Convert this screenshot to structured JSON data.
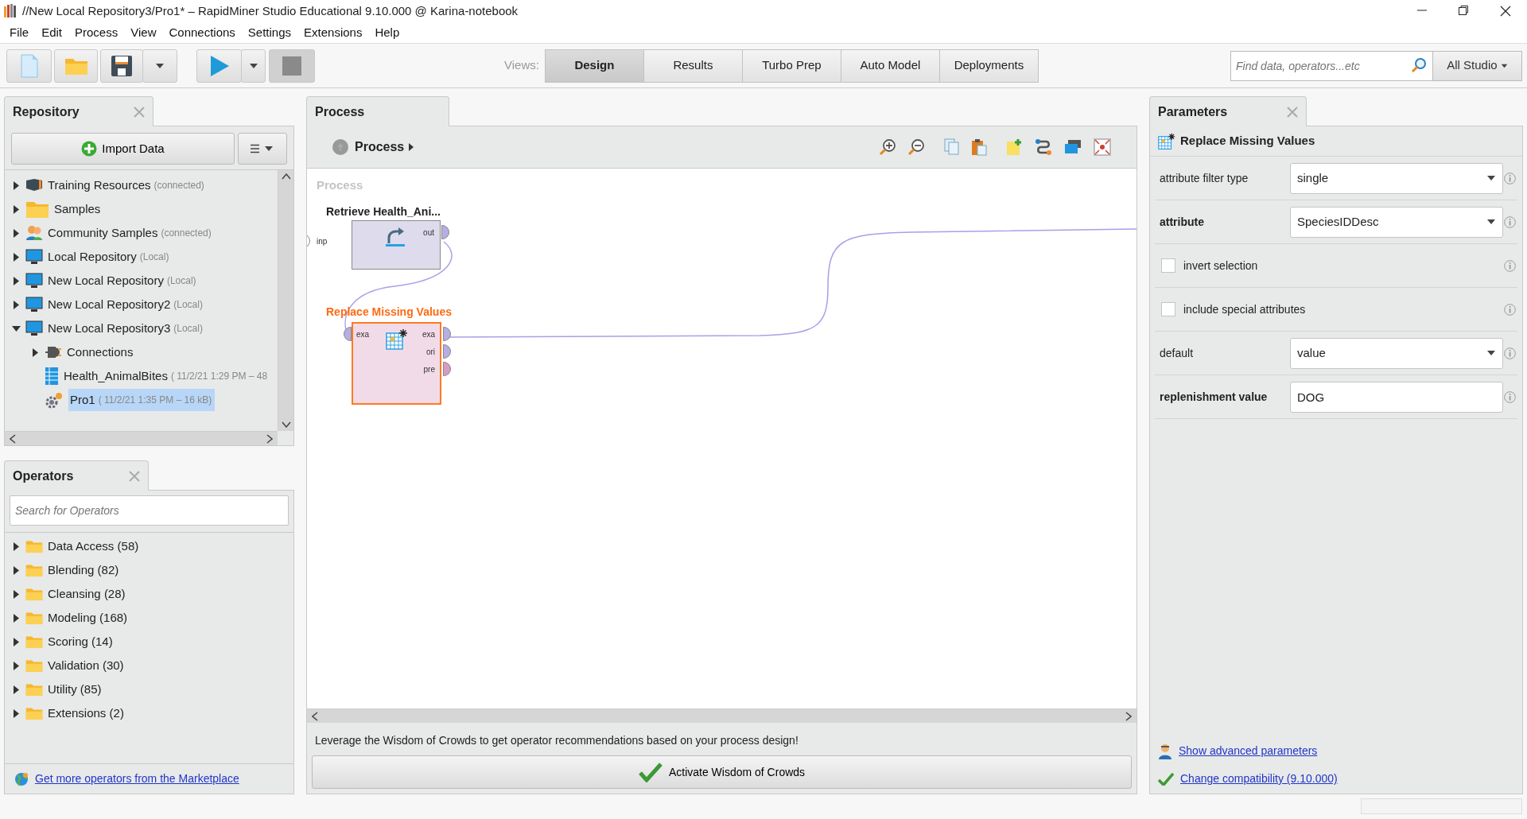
{
  "window": {
    "title": "//New Local Repository3/Pro1* – RapidMiner Studio Educational 9.10.000 @ Karina-notebook"
  },
  "menu": [
    "File",
    "Edit",
    "Process",
    "View",
    "Connections",
    "Settings",
    "Extensions",
    "Help"
  ],
  "toolbar": {
    "views_label": "Views:",
    "views": [
      {
        "label": "Design",
        "selected": true
      },
      {
        "label": "Results",
        "selected": false
      },
      {
        "label": "Turbo Prep",
        "selected": false
      },
      {
        "label": "Auto Model",
        "selected": false
      },
      {
        "label": "Deployments",
        "selected": false
      }
    ],
    "search_placeholder": "Find data, operators...etc",
    "scope": "All Studio"
  },
  "repository": {
    "title": "Repository",
    "import_button": "Import Data",
    "items": [
      {
        "kind": "training",
        "label": "Training Resources",
        "note": "(connected)",
        "expanded": false,
        "selected": false
      },
      {
        "kind": "folder",
        "label": "Samples",
        "expanded": false,
        "selected": false
      },
      {
        "kind": "community",
        "label": "Community Samples",
        "note": "(connected)",
        "expanded": false,
        "selected": false
      },
      {
        "kind": "repository",
        "label": "Local Repository",
        "note": "(Local)",
        "expanded": false,
        "selected": false
      },
      {
        "kind": "repository",
        "label": "New Local Repository",
        "note": "(Local)",
        "expanded": false,
        "selected": false
      },
      {
        "kind": "repository",
        "label": "New Local Repository2",
        "note": "(Local)",
        "expanded": false,
        "selected": false
      },
      {
        "kind": "repository",
        "label": "New Local Repository3",
        "note": "(Local)",
        "expanded": true,
        "selected": false,
        "children": [
          {
            "kind": "connections",
            "label": "Connections",
            "expanded": false,
            "selected": false
          },
          {
            "kind": "data",
            "label": "Health_AnimalBites",
            "note": "( 11/2/21 1:29 PM – 48",
            "selected": false
          },
          {
            "kind": "process",
            "label": "Pro1",
            "note": "( 11/2/21 1:35 PM – 16 kB)",
            "selected": true
          }
        ]
      }
    ]
  },
  "operators_panel": {
    "title": "Operators",
    "search_placeholder": "Search for Operators",
    "items": [
      {
        "label": "Data Access (58)",
        "expanded": false
      },
      {
        "label": "Blending (82)",
        "expanded": false
      },
      {
        "label": "Cleansing (28)",
        "expanded": false
      },
      {
        "label": "Modeling (168)",
        "expanded": false
      },
      {
        "label": "Scoring (14)",
        "expanded": false
      },
      {
        "label": "Validation (30)",
        "expanded": false
      },
      {
        "label": "Utility (85)",
        "expanded": false
      },
      {
        "label": "Extensions (2)",
        "expanded": false
      }
    ],
    "marketplace_link": "Get more operators from the Marketplace"
  },
  "process": {
    "tab": "Process",
    "breadcrumb": "Process",
    "canvas_label": "Process",
    "process_ports": [
      "inp"
    ],
    "operators": [
      {
        "kind": "retrieve",
        "title": "Retrieve Health_Ani...",
        "selected": false,
        "outputs": [
          {
            "label": "out",
            "color": "#b6aee3"
          }
        ]
      },
      {
        "kind": "replace",
        "title": "Replace Missing Values",
        "selected": true,
        "inputs": [
          {
            "label": "exa",
            "color": "#b6aee3"
          }
        ],
        "outputs": [
          {
            "label": "exa",
            "color": "#b6aee3"
          },
          {
            "label": "ori",
            "color": "#b6aee3"
          },
          {
            "label": "pre",
            "color": "#d99ac6"
          }
        ]
      }
    ],
    "wisdom_text": "Leverage the Wisdom of Crowds to get operator recommendations based on your process design!",
    "wisdom_button": "Activate Wisdom of Crowds"
  },
  "parameters": {
    "title": "Parameters",
    "operator": "Replace Missing Values",
    "rows": [
      {
        "kind": "select",
        "label": "attribute filter type",
        "required": false,
        "value": "single"
      },
      {
        "kind": "select",
        "label": "attribute",
        "required": true,
        "value": "SpeciesIDDesc"
      },
      {
        "kind": "checkbox",
        "label": "invert selection",
        "checked": false
      },
      {
        "kind": "checkbox",
        "label": "include special attributes",
        "checked": false
      },
      {
        "kind": "select",
        "label": "default",
        "required": false,
        "value": "value"
      },
      {
        "kind": "text",
        "label": "replenishment value",
        "required": true,
        "value": "DOG"
      }
    ],
    "links": [
      {
        "kind": "advanced",
        "label": "Show advanced parameters"
      },
      {
        "kind": "compatibility",
        "label": "Change compatibility (9.10.000)"
      }
    ]
  }
}
